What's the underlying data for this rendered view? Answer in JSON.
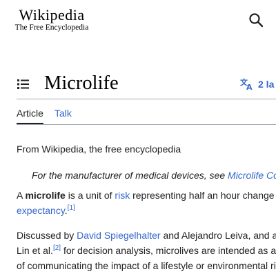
{
  "header": {
    "logo_wordmark": "Wikipedia",
    "logo_tagline": "The Free Encyclopedia",
    "search_icon": "search-icon"
  },
  "page": {
    "toc_icon": "list-icon",
    "title": "Microlife",
    "languages_label": "2 la",
    "languages_icon": "translate-icon"
  },
  "tabs": [
    {
      "label": "Article",
      "selected": true
    },
    {
      "label": "Talk",
      "selected": false
    }
  ],
  "content": {
    "tagline": "From Wikipedia, the free encyclopedia",
    "hatnote": {
      "prefix": "For the manufacturer of medical devices, see ",
      "link": "Microlife Co"
    },
    "para1": {
      "t1": "A ",
      "bold": "microlife",
      "t2": " is a unit of ",
      "link1": "risk",
      "t3": " representing half an hour change",
      "link2": "expectancy",
      "t4": ".",
      "ref1": "[1]"
    },
    "para2": {
      "t1": "Discussed by ",
      "link1": "David Spiegelhalter",
      "t2": " and Alejandro Leiva, and a",
      "t3": "Lin et al.",
      "ref2": "[2]",
      "t4": " for decision analysis, microlives are intended as a",
      "t5": "of communicating the impact of a lifestyle or environmental ri"
    }
  },
  "colors": {
    "link": "#3366cc",
    "text": "#202122",
    "rule": "#a2a9b1"
  }
}
